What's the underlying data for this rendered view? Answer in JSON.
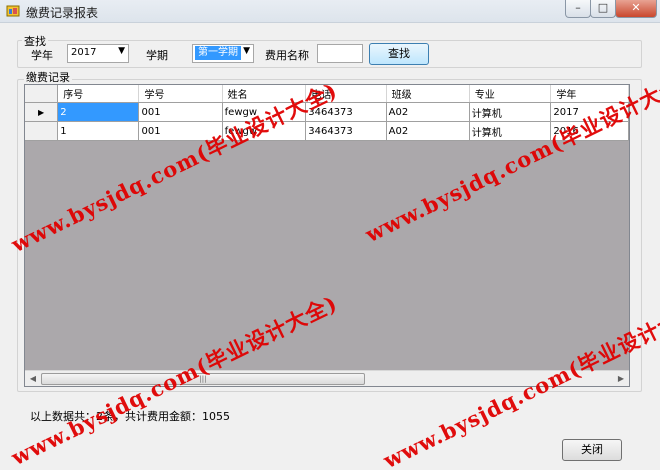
{
  "window": {
    "title": "缴费记录报表",
    "controls": {
      "minimize": "–",
      "maximize": "□",
      "close": "✕"
    }
  },
  "search": {
    "group_label": "查找",
    "year_label": "学年",
    "year_value": "2017",
    "term_label": "学期",
    "term_value": "第一学期",
    "fee_label": "费用名称",
    "fee_value": "",
    "search_button": "查找"
  },
  "records": {
    "group_label": "缴费记录",
    "columns": [
      "序号",
      "学号",
      "姓名",
      "电话",
      "班级",
      "专业",
      "学年"
    ],
    "rows": [
      [
        "2",
        "001",
        "fewgw",
        "3464373",
        "A02",
        "计算机",
        "2017"
      ],
      [
        "1",
        "001",
        "fewgw",
        "3464373",
        "A02",
        "计算机",
        "2016"
      ]
    ],
    "current_row_marker": "▶"
  },
  "scrollbar": {
    "left": "◀",
    "right": "▶",
    "grip": "|||"
  },
  "summary": "以上数据共：2条，共计费用金额：1055",
  "close_button": "关闭",
  "watermark": "www.bysjdq.com(毕业设计大全)",
  "colors": {
    "selection": "#3399ff",
    "grid_background": "#aba8ab",
    "watermark": "#e00000"
  }
}
